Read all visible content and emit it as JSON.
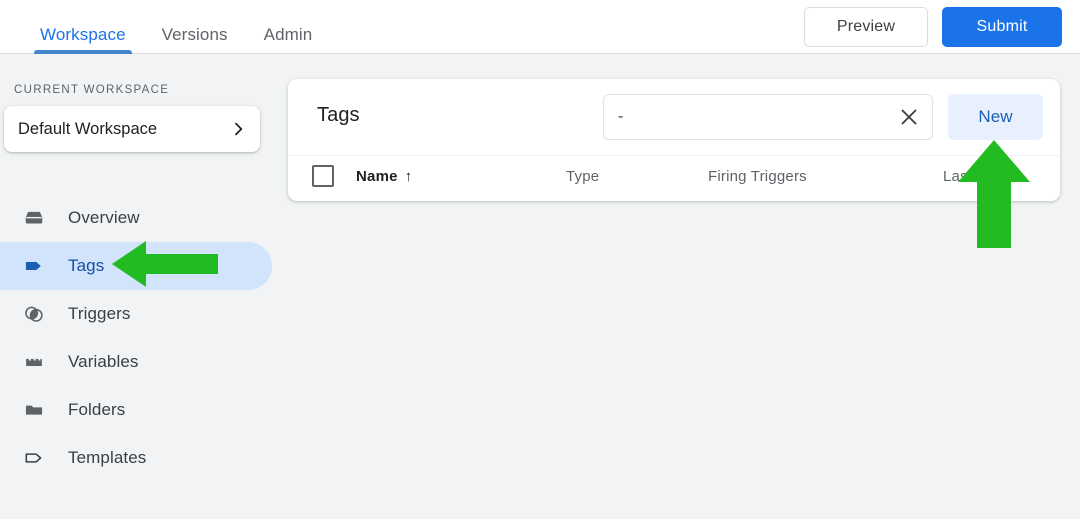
{
  "header": {
    "tabs": [
      {
        "label": "Workspace",
        "active": true
      },
      {
        "label": "Versions",
        "active": false
      },
      {
        "label": "Admin",
        "active": false
      }
    ],
    "preview_label": "Preview",
    "submit_label": "Submit",
    "active_tab_color": "#1a73e8",
    "submit_color": "#1a73e8"
  },
  "sidebar": {
    "section_label": "CURRENT WORKSPACE",
    "workspace_name": "Default Workspace",
    "workspace_chevron_icon": "chevron-right-icon",
    "items": [
      {
        "label": "Overview",
        "icon": "inbox-icon",
        "active": false
      },
      {
        "label": "Tags",
        "icon": "tag-filled-icon",
        "active": true
      },
      {
        "label": "Triggers",
        "icon": "overlapping-circles-icon",
        "active": false
      },
      {
        "label": "Variables",
        "icon": "blocks-icon",
        "active": false
      },
      {
        "label": "Folders",
        "icon": "folder-icon",
        "active": false
      },
      {
        "label": "Templates",
        "icon": "tag-outline-icon",
        "active": false
      }
    ],
    "active_item_bg": "#d2e3fc"
  },
  "main": {
    "card_title": "Tags",
    "search": {
      "value": "-",
      "placeholder": "",
      "clear_icon": "close-icon"
    },
    "new_button_label": "New",
    "new_button_bg": "#e8f0fe",
    "table": {
      "select_all_checkbox": "checkbox-unchecked",
      "columns": [
        {
          "label": "Name",
          "sorted": true,
          "sort_icon": "arrow-up-icon"
        },
        {
          "label": "Type",
          "sorted": false
        },
        {
          "label": "Firing Triggers",
          "sorted": false
        },
        {
          "label": "Last Edited",
          "sorted": false
        }
      ],
      "rows": []
    }
  },
  "annotations": [
    {
      "name": "green-arrow-pointing-at-tags",
      "direction": "left",
      "color": "#22bb22"
    },
    {
      "name": "green-arrow-pointing-at-new-button",
      "direction": "up",
      "color": "#22bb22"
    }
  ]
}
